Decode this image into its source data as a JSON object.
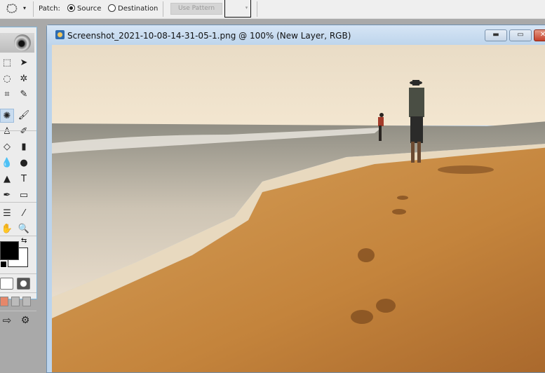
{
  "options_bar": {
    "tool_preset_arrow": "▾",
    "patch_label": "Patch:",
    "radio_source": {
      "label": "Source",
      "selected": true
    },
    "radio_destination": {
      "label": "Destination",
      "selected": false
    },
    "use_pattern_label": "Use Pattern",
    "pattern_dropdown_arrow": "▾"
  },
  "toolbox": {
    "tools": [
      {
        "name": "marquee",
        "glyph": "⬚"
      },
      {
        "name": "move",
        "glyph": "➤"
      },
      {
        "name": "lasso",
        "glyph": "◌"
      },
      {
        "name": "magic-wand",
        "glyph": "✲"
      },
      {
        "name": "crop",
        "glyph": "⌗"
      },
      {
        "name": "slice",
        "glyph": "✎"
      },
      {
        "name": "patch",
        "glyph": "✺",
        "selected": true
      },
      {
        "name": "brush",
        "glyph": "🖌"
      },
      {
        "name": "clone-stamp",
        "glyph": "♙"
      },
      {
        "name": "history-brush",
        "glyph": "✐"
      },
      {
        "name": "eraser",
        "glyph": "◇"
      },
      {
        "name": "gradient",
        "glyph": "▮"
      },
      {
        "name": "blur",
        "glyph": "💧"
      },
      {
        "name": "dodge",
        "glyph": "●"
      },
      {
        "name": "path-selection",
        "glyph": "▲"
      },
      {
        "name": "type",
        "glyph": "T"
      },
      {
        "name": "pen",
        "glyph": "✒"
      },
      {
        "name": "rectangle",
        "glyph": "▭"
      },
      {
        "name": "notes",
        "glyph": "☰"
      },
      {
        "name": "eyedropper",
        "glyph": "⁄"
      },
      {
        "name": "hand",
        "glyph": "✋"
      },
      {
        "name": "zoom",
        "glyph": "🔍"
      }
    ],
    "swap_glyph": "⇆",
    "colors": {
      "foreground": "#000000",
      "background": "#ffffff"
    }
  },
  "document": {
    "title": "Screenshot_2021-10-08-14-31-05-1.png @ 100% (New Layer, RGB)",
    "minimize_glyph": "▬",
    "maximize_glyph": "▭",
    "close_glyph": "✕"
  },
  "image": {
    "description": "beach scene with two people and footprints in sand",
    "sky": "#efe2cc",
    "sea": "#b9b2a3",
    "sand": "#c98a3f"
  }
}
